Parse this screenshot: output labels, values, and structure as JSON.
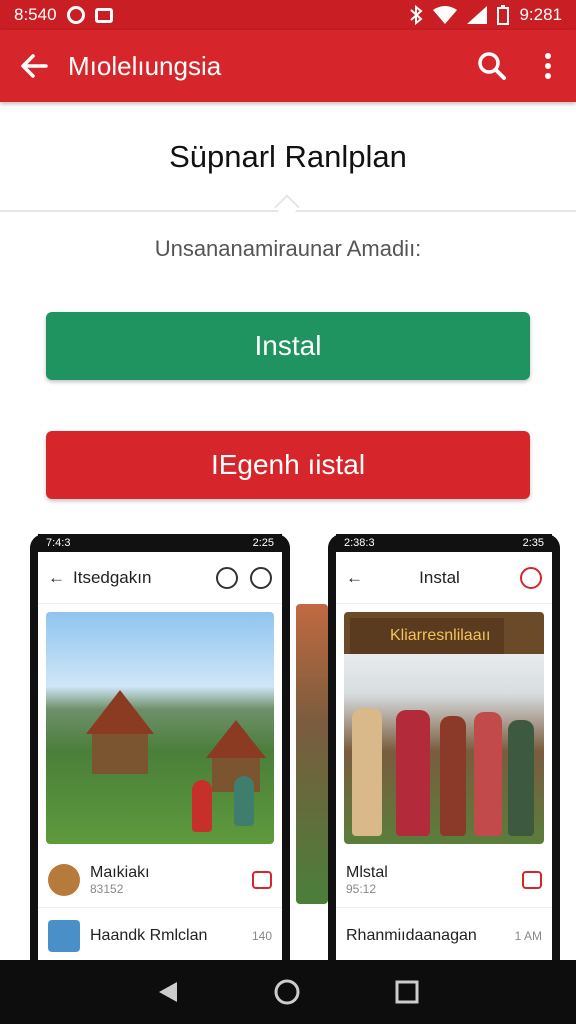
{
  "status_bar": {
    "time_left": "8:540",
    "time_right": "9:281"
  },
  "app_bar": {
    "title": "Mıolelıungsia"
  },
  "header": {
    "heading": "Süpnarl Ranlplan",
    "subtitle": "Unsananamiraunar Amadiı:"
  },
  "buttons": {
    "install": "Instal",
    "uninstall": "IEgenh ıistal"
  },
  "screenshots": [
    {
      "status_time": "7:4:3",
      "status_right": "2:25",
      "title": "Itsedgakın",
      "rows": [
        {
          "name": "Maıkiakı",
          "meta": "83152"
        },
        {
          "name": "Haandk Rmlclan",
          "meta": "140"
        }
      ]
    },
    {
      "status_time": "2:38:3",
      "status_right": "2:35",
      "title": "Instal",
      "sign": "Kliarresnlilaaıı",
      "rows": [
        {
          "name": "Mlstal",
          "meta": "95:12"
        },
        {
          "name": "Rhanmiıdaanagan",
          "meta": "1 AM"
        }
      ]
    }
  ],
  "icons": [
    "back-arrow-icon",
    "search-icon",
    "more-vert-icon",
    "bluetooth-icon",
    "wifi-icon",
    "signal-icon",
    "battery-icon",
    "nav-back-icon",
    "nav-home-icon",
    "nav-recents-icon"
  ],
  "colors": {
    "primary_red": "#d7262b",
    "install_green": "#1f9460",
    "uninstall_red": "#d7262b"
  }
}
